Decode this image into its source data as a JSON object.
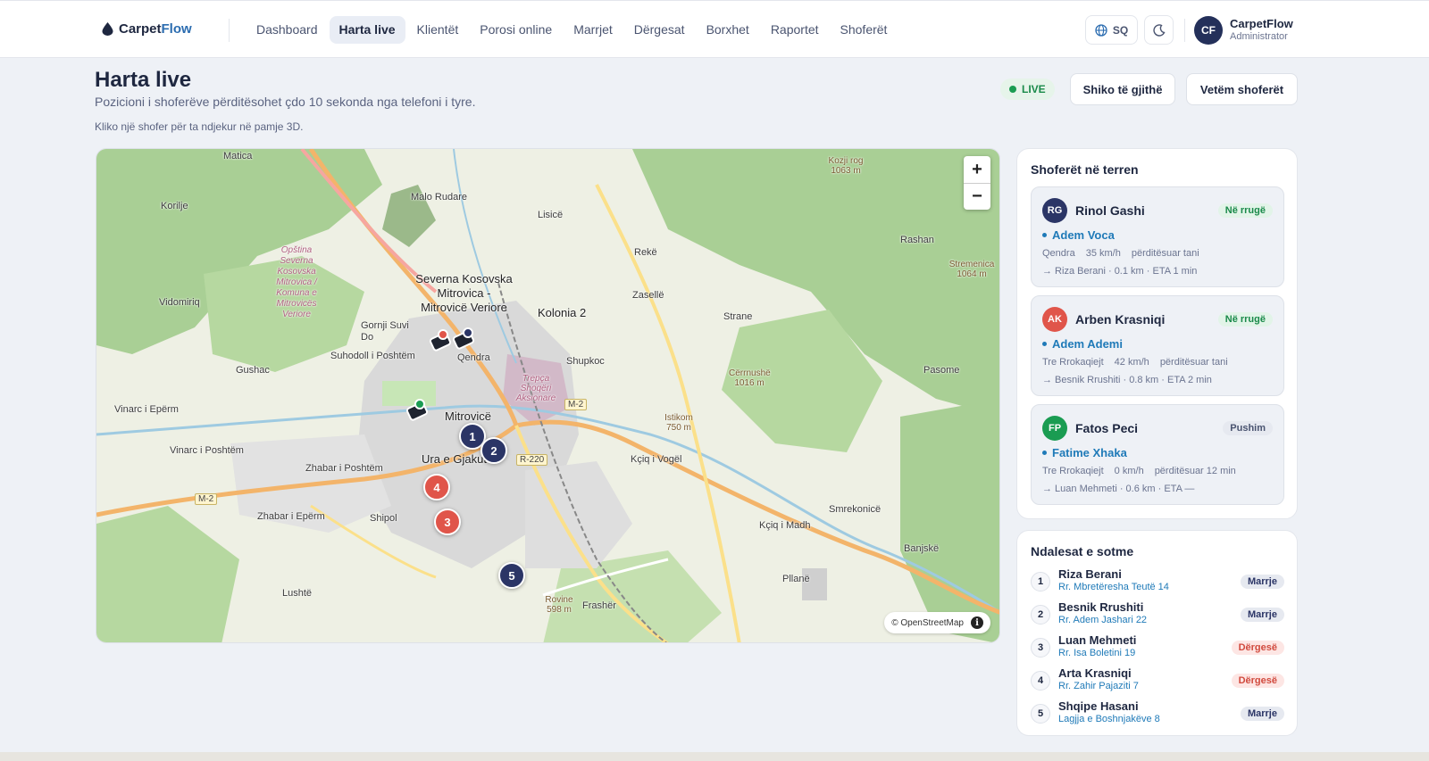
{
  "app": {
    "brand_a": "Carpet",
    "brand_b": "Flow"
  },
  "nav": [
    {
      "label": "Dashboard",
      "active": false
    },
    {
      "label": "Harta live",
      "active": true
    },
    {
      "label": "Klientët",
      "active": false
    },
    {
      "label": "Porosi online",
      "active": false
    },
    {
      "label": "Marrjet",
      "active": false
    },
    {
      "label": "Dërgesat",
      "active": false
    },
    {
      "label": "Borxhet",
      "active": false
    },
    {
      "label": "Raportet",
      "active": false
    },
    {
      "label": "Shoferët",
      "active": false
    }
  ],
  "header": {
    "lang": "SQ",
    "user_initials": "CF",
    "user_name": "CarpetFlow",
    "user_role": "Administrator"
  },
  "page": {
    "title": "Harta live",
    "subtitle": "Pozicioni i shoferëve përditësohet çdo 10 sekonda nga telefoni i tyre.",
    "hint": "Kliko një shofer për ta ndjekur në pamje 3D.",
    "live": "LIVE",
    "btn_all": "Shiko të gjithë",
    "btn_drivers": "Vetëm shoferët"
  },
  "map": {
    "attribution": "© OpenStreetMap",
    "zoom_in": "+",
    "zoom_out": "−",
    "places": [
      "Matica",
      "Korilje",
      "Malo Rudare",
      "Lisicë",
      "Vidomiriq",
      "Gornji Suvi Do",
      "Suhodoll i Poshtëm",
      "Severna Kosovska Mitrovica - Mitrovicë Veriore",
      "Kolonia 2",
      "Qendra",
      "Mitrovicë",
      "Ura e Gjakut",
      "Gushac",
      "Vinarc i Epërm",
      "Vinarc i Poshtëm",
      "Zhabar i Poshtëm",
      "Zhabar i Epërm",
      "Shipol",
      "Lushtë",
      "Frashër",
      "Shupkoc",
      "Zasellë",
      "Rekë",
      "Strane",
      "Rashan",
      "Pasome",
      "Kçiq i Vogël",
      "Kçiq i Madh",
      "Smrekonicë",
      "Banjskë",
      "Pllanë",
      "Cërrnushë 1016 m",
      "Istikom 750 m",
      "Rovine 598 m",
      "Kozji rog 1063 m",
      "Stremenica 1064 m"
    ],
    "road_signs": [
      "M-2",
      "R-220",
      "M-2"
    ],
    "nature": "Opština Severna Kosovska Mitrovica / Komuna e Mitrovicës Veriore",
    "nature2": "Trepça Shoqëri Aksionare",
    "markers": [
      {
        "n": "1",
        "type": "pick"
      },
      {
        "n": "2",
        "type": "pick"
      },
      {
        "n": "3",
        "type": "drop"
      },
      {
        "n": "4",
        "type": "drop"
      },
      {
        "n": "5",
        "type": "pick"
      }
    ]
  },
  "drivers": {
    "title": "Shoferët në terren",
    "items": [
      {
        "initials": "RG",
        "name": "Rinol Gashi",
        "status": "Në rrugë",
        "client": "Adem Voca",
        "zone": "Qendra",
        "speed": "35 km/h",
        "updated": "përditësuar tani",
        "next": "→ Riza Berani · 0.1 km · ETA 1 min",
        "color": "#2b3566"
      },
      {
        "initials": "AK",
        "name": "Arben Krasniqi",
        "status": "Në rrugë",
        "client": "Adem Ademi",
        "zone": "Tre Rrokaqiejt",
        "speed": "42 km/h",
        "updated": "përditësuar tani",
        "next": "→ Besnik Rrushiti · 0.8 km · ETA 2 min",
        "color": "#e0554a"
      },
      {
        "initials": "FP",
        "name": "Fatos Peci",
        "status": "Pushim",
        "client": "Fatime Xhaka",
        "zone": "Tre Rrokaqiejt",
        "speed": "0 km/h",
        "updated": "përditësuar 12 min",
        "next": "→ Luan Mehmeti · 0.6 km · ETA —",
        "color": "#1a9c52"
      }
    ]
  },
  "stops": {
    "title": "Ndalesat e sotme",
    "items": [
      {
        "n": "1",
        "name": "Riza Berani",
        "addr": "Rr. Mbretëresha Teutë 14",
        "tag": "Marrje",
        "type": "pick"
      },
      {
        "n": "2",
        "name": "Besnik Rrushiti",
        "addr": "Rr. Adem Jashari 22",
        "tag": "Marrje",
        "type": "pick"
      },
      {
        "n": "3",
        "name": "Luan Mehmeti",
        "addr": "Rr. Isa Boletini 19",
        "tag": "Dërgesë",
        "type": "drop"
      },
      {
        "n": "4",
        "name": "Arta Krasniqi",
        "addr": "Rr. Zahir Pajaziti 7",
        "tag": "Dërgesë",
        "type": "drop"
      },
      {
        "n": "5",
        "name": "Shqipe Hasani",
        "addr": "Lagjja e Boshnjakëve 8",
        "tag": "Marrje",
        "type": "pick"
      }
    ]
  }
}
